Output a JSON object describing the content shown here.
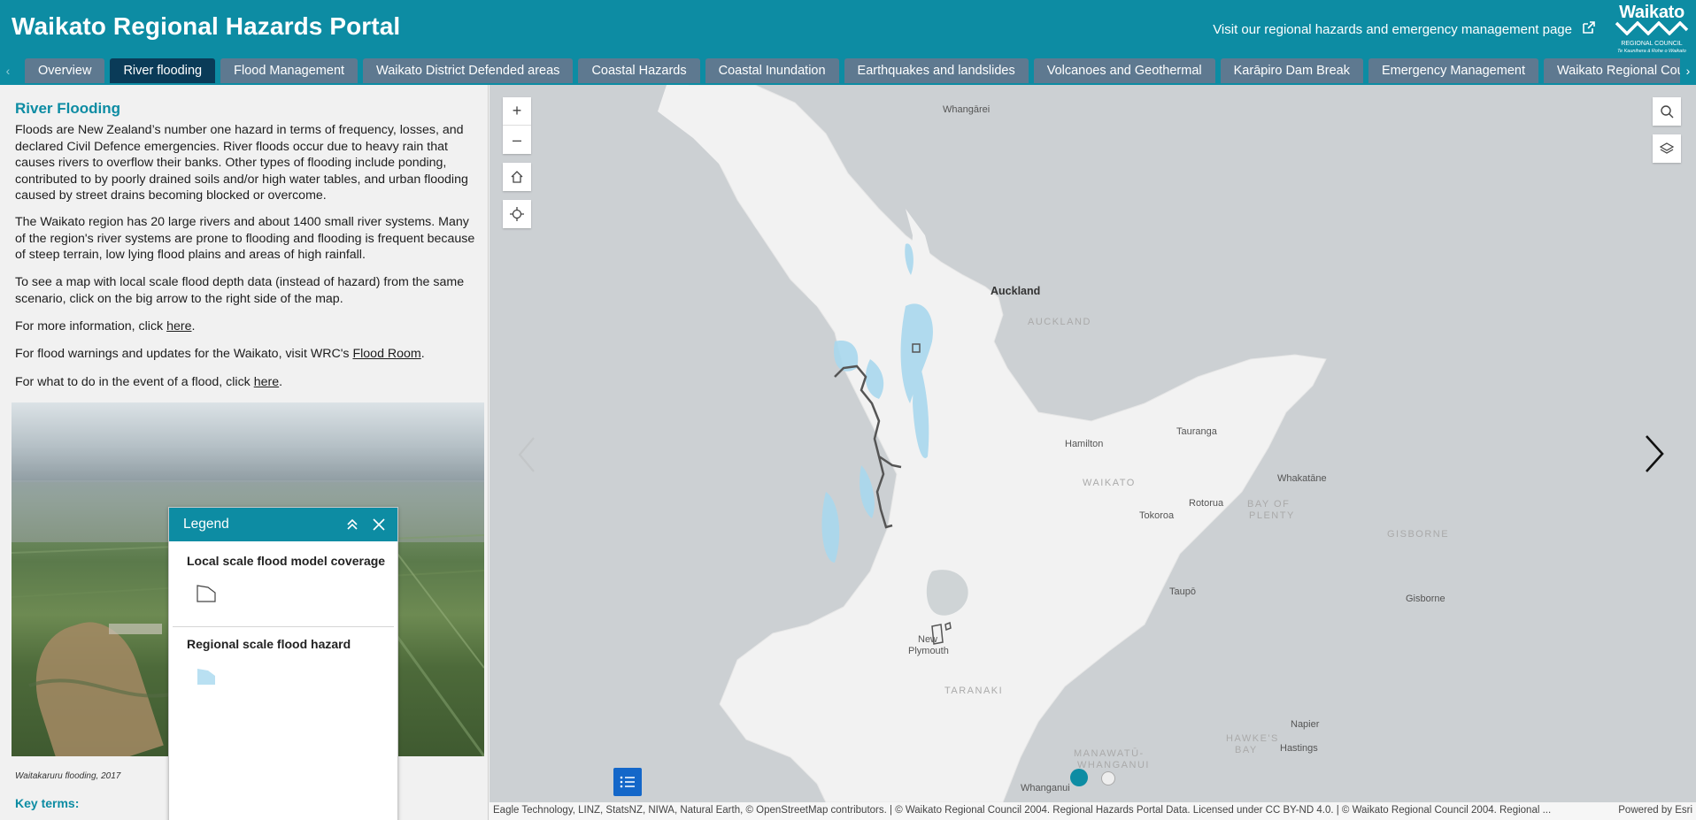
{
  "header": {
    "title": "Waikato Regional Hazards Portal",
    "visit_link": "Visit our regional hazards and emergency management page",
    "logo_word": "Waikato",
    "logo_sub1": "REGIONAL COUNCIL",
    "logo_sub2": "Te Kaunihera ā Rohe o Waikato"
  },
  "tabs": [
    {
      "label": "Overview"
    },
    {
      "label": "River flooding"
    },
    {
      "label": "Flood Management"
    },
    {
      "label": "Waikato District Defended areas"
    },
    {
      "label": "Coastal Hazards"
    },
    {
      "label": "Coastal Inundation"
    },
    {
      "label": "Earthquakes and landslides"
    },
    {
      "label": "Volcanoes and Geothermal"
    },
    {
      "label": "Karāpiro Dam Break"
    },
    {
      "label": "Emergency Management"
    },
    {
      "label": "Waikato Regional Cou"
    }
  ],
  "active_tab": "River flooding",
  "sidebar": {
    "title": "River Flooding",
    "p1": "Floods are New Zealand’s number one hazard in terms of frequency, losses, and declared Civil Defence emergencies. River floods occur due to heavy rain that causes rivers to overflow their banks. Other types of flooding include ponding, contributed to by poorly drained soils and/or high water tables, and urban flooding caused by street drains becoming blocked or overcome.",
    "p2": "The Waikato region has 20 large rivers and about 1400 small river systems. Many of the region's river systems are prone to flooding and flooding is frequent because of steep terrain, low lying flood plains and areas of high rainfall.",
    "p3": "To see a map with local scale flood depth data (instead of hazard) from the same scenario, click on the big arrow to the right side of the map.",
    "p4_prefix": "For more information, click ",
    "p4_link": "here",
    "p4_suffix": ".",
    "p5_prefix": "For flood warnings and updates for the Waikato, visit WRC's ",
    "p5_link": "Flood Room",
    "p5_suffix": ".",
    "p6_prefix": "For what to do in the event of a flood, click ",
    "p6_link": "here",
    "p6_suffix": ".",
    "caption": "Waitakaruru flooding, 2017",
    "key_terms": "Key terms:"
  },
  "legend": {
    "title": "Legend",
    "item1": "Local scale flood model coverage",
    "item2": "Regional scale flood hazard",
    "item1_color": "#ffffff",
    "item2_color": "#b9e0f2"
  },
  "map": {
    "labels": {
      "whangarei": "Whangārei",
      "auckland_city": "Auckland",
      "auckland_region": "AUCKLAND",
      "hamilton": "Hamilton",
      "waikato_region": "WAIKATO",
      "tauranga": "Tauranga",
      "whakatane": "Whakatāne",
      "rotorua": "Rotorua",
      "bop_1": "BAY OF",
      "bop_2": "PLENTY",
      "tokoroa": "Tokoroa",
      "gisborne_region": "GISBORNE",
      "gisborne_city": "Gisborne",
      "taupo": "Taupō",
      "new_plymouth_1": "New",
      "new_plymouth_2": "Plymouth",
      "taranaki": "TARANAKI",
      "napier": "Napier",
      "hawkes_1": "HAWKE'S",
      "hawkes_2": "BAY",
      "hastings": "Hastings",
      "manawatu_1": "MANAWATŪ-",
      "manawatu_2": "WHANGANUI",
      "whanganui": "Whanganui"
    },
    "attribution": "Eagle Technology, LINZ, StatsNZ, NIWA, Natural Earth, © OpenStreetMap contributors. | © Waikato Regional Council 2004. Regional Hazards Portal Data. Licensed under CC BY-ND 4.0. | © Waikato Regional Council 2004. Regional ...",
    "powered_by": "Powered by Esri",
    "flood_color": "#a9d8ee",
    "land_color": "#f2f2f2",
    "water_color": "#ccd0d3"
  },
  "icons": {
    "external": "external-link-icon",
    "zoom_in": "plus-icon",
    "zoom_out": "minus-icon",
    "home": "home-icon",
    "locate": "locate-icon",
    "search": "search-icon",
    "layers": "layers-icon",
    "legend": "list-icon"
  },
  "zoom_in_label": "+",
  "zoom_out_label": "–"
}
